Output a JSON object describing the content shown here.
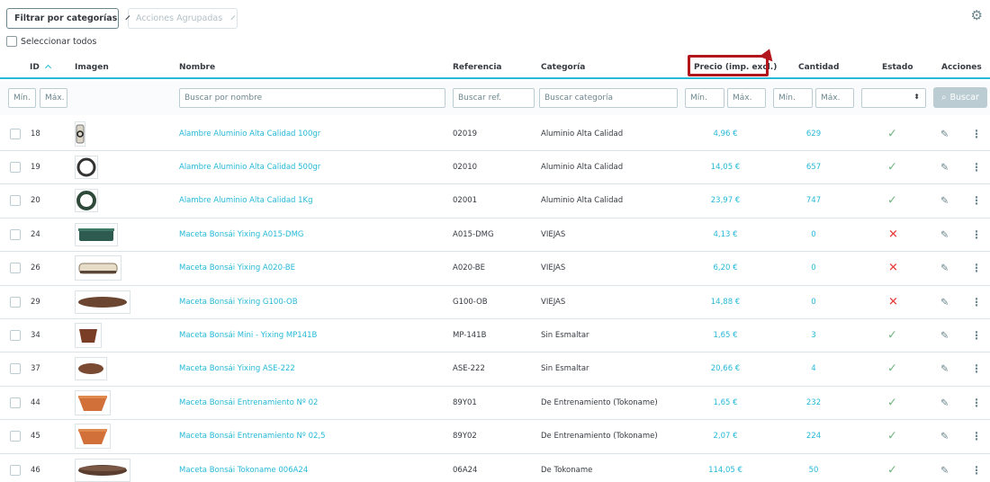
{
  "toolbar": {
    "filter_label": "Filtrar por categorías",
    "bulk_label": "Acciones Agrupadas"
  },
  "select_all_label": "Seleccionar todos",
  "columns": {
    "id": "ID",
    "image": "Imagen",
    "name": "Nombre",
    "reference": "Referencia",
    "category": "Categoría",
    "price": "Precio (imp. excl.)",
    "quantity": "Cantidad",
    "status": "Estado",
    "actions": "Acciones"
  },
  "filters": {
    "min": "Mín.",
    "max": "Máx.",
    "name_placeholder": "Buscar por nombre",
    "ref_placeholder": "Buscar ref.",
    "category_placeholder": "Buscar categoría",
    "search_button": "Buscar"
  },
  "colors": {
    "accent": "#25b9d7",
    "annotation": "#b3171e",
    "ok": "#70b580",
    "error": "#e53935"
  },
  "rows": [
    {
      "id": "18",
      "name": "Alambre Aluminio Alta Calidad 100gr",
      "ref": "02019",
      "category": "Aluminio Alta Calidad",
      "price": "4,96 €",
      "qty": "629",
      "active": true,
      "img": "wire-small"
    },
    {
      "id": "19",
      "name": "Alambre Aluminio Alta Calidad 500gr",
      "ref": "02010",
      "category": "Aluminio Alta Calidad",
      "price": "14,05 €",
      "qty": "657",
      "active": true,
      "img": "wire-coil"
    },
    {
      "id": "20",
      "name": "Alambre Aluminio Alta Calidad 1Kg",
      "ref": "02001",
      "category": "Aluminio Alta Calidad",
      "price": "23,97 €",
      "qty": "747",
      "active": true,
      "img": "wire-coil-green"
    },
    {
      "id": "24",
      "name": "Maceta Bonsái Yixing A015-DMG",
      "ref": "A015-DMG",
      "category": "VIEJAS",
      "price": "4,13 €",
      "qty": "0",
      "active": false,
      "img": "pot-green"
    },
    {
      "id": "26",
      "name": "Maceta Bonsái Yixing A020-BE",
      "ref": "A020-BE",
      "category": "VIEJAS",
      "price": "6,20 €",
      "qty": "0",
      "active": false,
      "img": "pot-beige"
    },
    {
      "id": "29",
      "name": "Maceta Bonsái Yixing G100-OB",
      "ref": "G100-OB",
      "category": "VIEJAS",
      "price": "14,88 €",
      "qty": "0",
      "active": false,
      "img": "pot-brown-wide"
    },
    {
      "id": "34",
      "name": "Maceta Bonsái Mini - Yixing MP141B",
      "ref": "MP-141B",
      "category": "Sin Esmaltar",
      "price": "1,65 €",
      "qty": "3",
      "active": true,
      "img": "pot-mini"
    },
    {
      "id": "37",
      "name": "Maceta Bonsái Yixing ASE-222",
      "ref": "ASE-222",
      "category": "Sin Esmaltar",
      "price": "20,66 €",
      "qty": "4",
      "active": true,
      "img": "pot-brown-oval"
    },
    {
      "id": "44",
      "name": "Maceta Bonsái Entrenamiento Nº 02",
      "ref": "89Y01",
      "category": "De Entrenamiento (Tokoname)",
      "price": "1,65 €",
      "qty": "232",
      "active": true,
      "img": "pot-terracotta"
    },
    {
      "id": "45",
      "name": "Maceta Bonsái Entrenamiento Nº 02,5",
      "ref": "89Y02",
      "category": "De Entrenamiento (Tokoname)",
      "price": "2,07 €",
      "qty": "224",
      "active": true,
      "img": "pot-terracotta"
    },
    {
      "id": "46",
      "name": "Maceta Bonsái Tokoname 006A24",
      "ref": "06A24",
      "category": "De Tokoname",
      "price": "114,05 €",
      "qty": "50",
      "active": true,
      "img": "pot-dark-wide"
    }
  ]
}
